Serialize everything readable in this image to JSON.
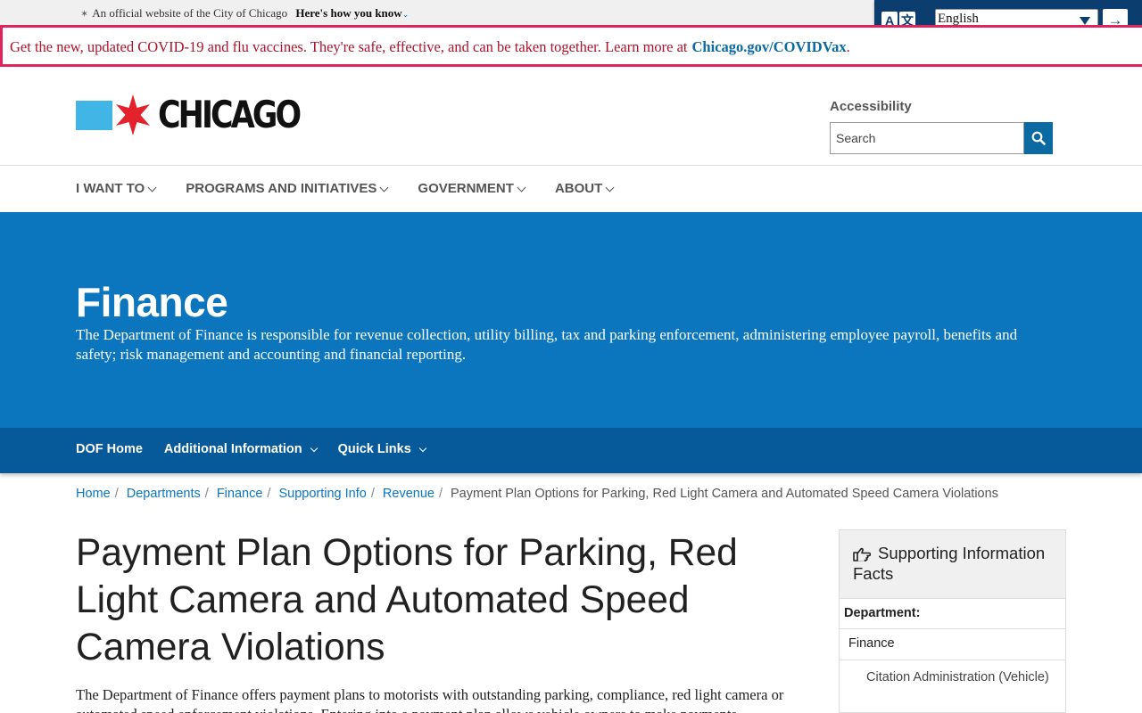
{
  "official_banner": {
    "text": "An official website of the City of Chicago",
    "link": "Here's how you know"
  },
  "translate": {
    "icon": "translate-icon",
    "language": "English",
    "go_icon": "arrow-right-icon"
  },
  "alert": {
    "text": "Get the new, updated COVID-19 and flu vaccines. They're safe, effective, and can be taken together. Learn more at",
    "link": "Chicago.gov/COVIDVax",
    "trailing": "."
  },
  "header": {
    "logo_text": "CHICAGO",
    "accessibility": "Accessibility",
    "search_placeholder": "Search",
    "colors": {
      "flag_blue": "#41b6e6",
      "flag_star": "#e4222c"
    }
  },
  "main_nav": [
    {
      "label": "I WANT TO"
    },
    {
      "label": "PROGRAMS AND INITIATIVES"
    },
    {
      "label": "GOVERNMENT"
    },
    {
      "label": "ABOUT"
    }
  ],
  "hero": {
    "title": "Finance",
    "description": "The Department of Finance is responsible for revenue collection, utility billing, tax and parking enforcement, administering employee payroll, benefits and safety; risk management and accounting and financial reporting.",
    "color": "#0b75be"
  },
  "sub_nav": [
    {
      "label": "DOF Home"
    },
    {
      "label": "Additional Information"
    },
    {
      "label": "Quick Links"
    }
  ],
  "breadcrumb": {
    "items": [
      "Home",
      "Departments",
      "Finance",
      "Supporting Info",
      "Revenue"
    ],
    "current": "Payment Plan Options for Parking, Red Light Camera and Automated Speed Camera Violations"
  },
  "page": {
    "title": "Payment Plan Options for Parking, Red Light Camera and Automated Speed Camera Violations",
    "intro": "The Department of Finance offers payment plans to motorists with outstanding parking, compliance, red light camera or automated speed enforcement violations. Entering into a payment plan allows vehicle owners to make payments"
  },
  "sidebar": {
    "heading": "Supporting Information Facts",
    "department_label": "Department:",
    "department": "Finance",
    "sub_department": "Citation Administration (Vehicle)"
  }
}
